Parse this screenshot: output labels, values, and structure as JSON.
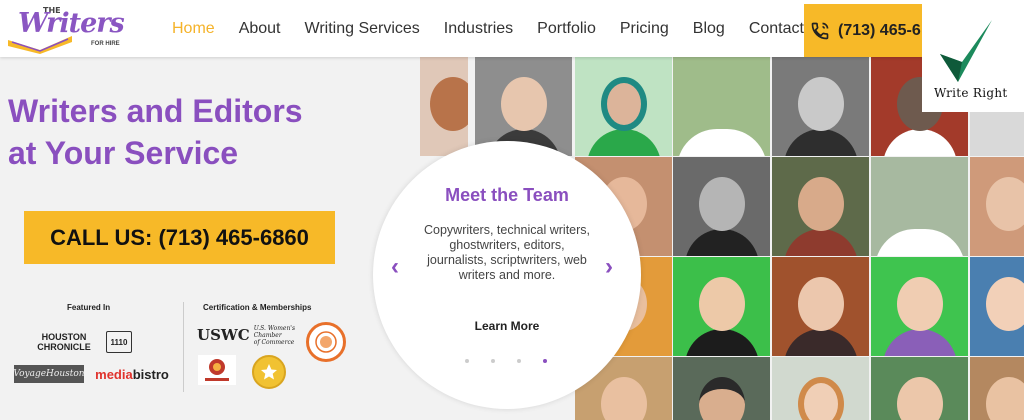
{
  "brand": {
    "logo_the": "THE",
    "logo_script": "Writers",
    "logo_sub": "FOR HIRE"
  },
  "nav": {
    "items": [
      {
        "label": "Home",
        "active": true
      },
      {
        "label": "About",
        "active": false
      },
      {
        "label": "Writing Services",
        "active": false
      },
      {
        "label": "Industries",
        "active": false
      },
      {
        "label": "Portfolio",
        "active": false
      },
      {
        "label": "Pricing",
        "active": false
      },
      {
        "label": "Blog",
        "active": false
      },
      {
        "label": "Contact",
        "active": false
      }
    ],
    "phone": "(713) 465-6"
  },
  "write_right": {
    "label": "Write Right"
  },
  "hero": {
    "title_line1": "Writers and Editors",
    "title_line2": "at Your Service",
    "call_label": "CALL US: (713) 465-6860"
  },
  "featured": {
    "label": "Featured In",
    "houston_line1": "HOUSTON",
    "houston_line2": "CHRONICLE",
    "kprc": "1110",
    "voyage": "VoyageHouston",
    "media_part": "media",
    "bistro_part": "bistro"
  },
  "certification": {
    "label": "Certification & Memberships",
    "uswcc_mark": "USWC",
    "uswcc_line1": "U.S. Women's Chamber",
    "uswcc_line2": "of Commerce"
  },
  "team": {
    "title": "Meet the Team",
    "description": "Copywriters, technical writers, ghostwriters, editors, journalists, scriptwriters, web writers and more.",
    "link_label": "Learn More",
    "prev_icon": "‹",
    "next_icon": "›",
    "slide_count": 4,
    "active_slide": 4
  },
  "colors": {
    "accent_purple": "#8a4fbf",
    "accent_gold": "#f7b928",
    "nav_active": "#f5b32a"
  }
}
